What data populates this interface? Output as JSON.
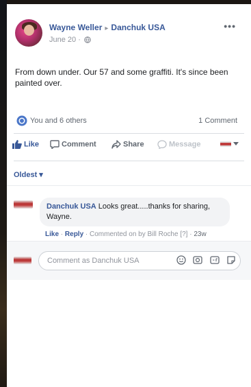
{
  "post": {
    "author": "Wayne Weller",
    "separator": "▸",
    "page": "Danchuk USA",
    "date": "June 20",
    "meta_dot": "·",
    "more": "•••",
    "text": "From down under. Our 57 and some graffiti. It's since been painted over."
  },
  "reactions": {
    "summary": "You and 6 others",
    "comments": "1 Comment"
  },
  "actions": {
    "like": "Like",
    "comment": "Comment",
    "share": "Share",
    "message": "Message"
  },
  "sort": {
    "label": "Oldest ▾"
  },
  "comment": {
    "author": "Danchuk USA",
    "text": " Looks great.....thanks for sharing, Wayne.",
    "like": "Like",
    "dot": " · ",
    "reply": "Reply",
    "attribution": " · Commented on by Bill Roche [?] · ",
    "time": "23w"
  },
  "write": {
    "placeholder": "Comment as Danchuk USA"
  },
  "colors": {
    "link": "#385898",
    "meta": "#90949c",
    "bubble": "#f2f3f5"
  }
}
